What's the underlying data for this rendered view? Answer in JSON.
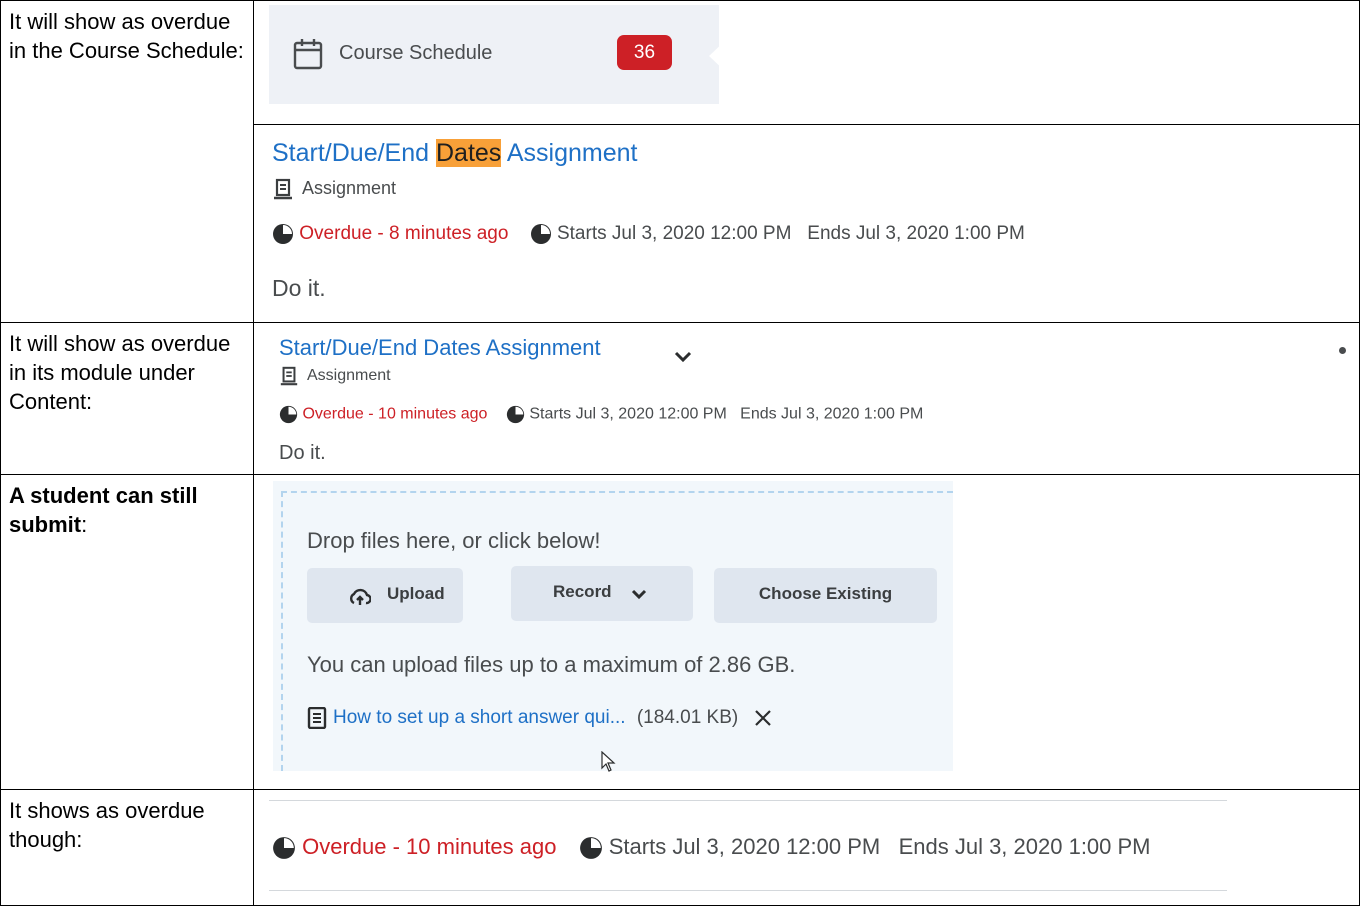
{
  "rows": [
    {
      "label": "It will show as overdue in the Course Schedule:"
    },
    {
      "label": "It will show as overdue in its module under Content:"
    },
    {
      "label_bold": "A student can still submit",
      "label_rest": ":"
    },
    {
      "label": "It shows as overdue though:"
    }
  ],
  "course_schedule": {
    "label": "Course Schedule",
    "badge": "36"
  },
  "card1": {
    "title_pre": "Start/Due/End ",
    "title_highlight": "Dates",
    "title_post": " Assignment",
    "type": "Assignment",
    "overdue": "Overdue - 8 minutes ago",
    "dates": "Starts Jul 3, 2020 12:00 PM   Ends Jul 3, 2020 1:00 PM",
    "body": "Do it."
  },
  "card2": {
    "title": "Start/Due/End Dates Assignment",
    "type": "Assignment",
    "overdue": "Overdue - 10 minutes ago",
    "dates": "Starts Jul 3, 2020 12:00 PM   Ends Jul 3, 2020 1:00 PM",
    "body": "Do it."
  },
  "upload": {
    "drop_text": "Drop files here, or click below!",
    "upload_btn": "Upload",
    "record_btn": "Record",
    "choose_btn": "Choose Existing",
    "limit_text": "You can upload files up to a maximum of 2.86 GB.",
    "file_name": "How to set up a short answer qui...",
    "file_size": "(184.01 KB)"
  },
  "row4": {
    "overdue": "Overdue - 10 minutes ago",
    "dates": "Starts Jul 3, 2020 12:00 PM   Ends Jul 3, 2020 1:00 PM"
  },
  "colors": {
    "link": "#1e70c6",
    "overdue": "#cd2026",
    "badge": "#cd2026",
    "highlight": "#f8a038"
  }
}
